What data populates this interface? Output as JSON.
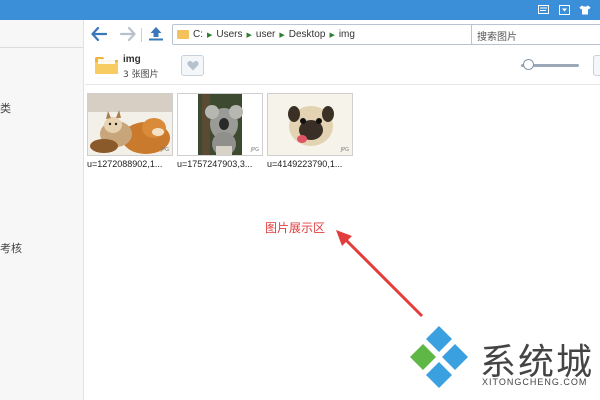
{
  "window": {
    "title_bar_color": "#3b8fd9"
  },
  "sidebar": {
    "items": [
      {
        "label": "类"
      },
      {
        "label": "考核"
      }
    ]
  },
  "toolbar": {
    "path": [
      "C:",
      "Users",
      "user",
      "Desktop",
      "img"
    ],
    "search_text": "搜索图片"
  },
  "folder": {
    "name": "img",
    "count": "3 张图片"
  },
  "zoom": {
    "level": 0.05
  },
  "files": [
    {
      "name": "u=1272088902,1..."
    },
    {
      "name": "u=1757247903,3..."
    },
    {
      "name": "u=4149223790,1..."
    }
  ],
  "annotation": {
    "text": "图片展示区",
    "color": "#e23c3c"
  },
  "watermark": {
    "title": "系统城",
    "url": "XITONGCHENG.COM"
  }
}
